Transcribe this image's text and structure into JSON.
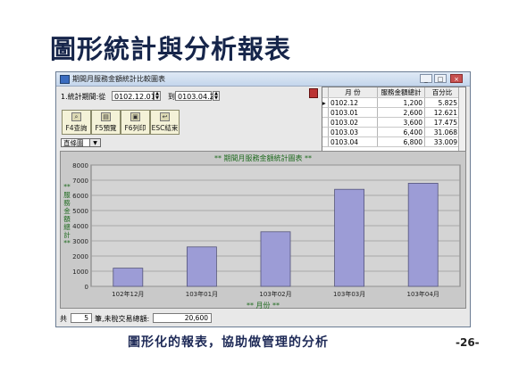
{
  "slide": {
    "title": "圖形統計與分析報表",
    "caption": "圖形化的報表，協助做管理的分析",
    "page_number": "-26-"
  },
  "window": {
    "title": "期間月服務金額統計比較圖表",
    "controls": {
      "minimize": "_",
      "maximize": "□",
      "close": "×"
    }
  },
  "filter": {
    "label": "1.統計期間:從",
    "from_value": "0102.12.01",
    "to_label": "到",
    "to_value": "0103.04.22"
  },
  "toolbar": {
    "buttons": [
      {
        "label": "F4查詢",
        "icon": "search-icon"
      },
      {
        "label": "F5預覽",
        "icon": "preview-icon"
      },
      {
        "label": "F6列印",
        "icon": "print-icon"
      },
      {
        "label": "ESC結束",
        "icon": "exit-icon"
      }
    ]
  },
  "chart_type_select": {
    "value": "直條圖"
  },
  "grid": {
    "headers": [
      "月  份",
      "服務金額總計",
      "百分比"
    ],
    "rows": [
      [
        "0102.12",
        "1,200",
        "5.825"
      ],
      [
        "0103.01",
        "2,600",
        "12.621"
      ],
      [
        "0103.02",
        "3,600",
        "17.475"
      ],
      [
        "0103.03",
        "6,400",
        "31.068"
      ],
      [
        "0103.04",
        "6,800",
        "33.009"
      ]
    ]
  },
  "status": {
    "prefix": "共",
    "count": "5",
    "middle": "筆,未稅交易總額:",
    "total": "20,600"
  },
  "chart_data": {
    "type": "bar",
    "title": "** 期間月服務金額統計圖表 **",
    "xlabel": "** 月份 **",
    "ylabel": "**服務金額總計**",
    "categories": [
      "102年12月",
      "103年01月",
      "103年02月",
      "103年03月",
      "103年04月"
    ],
    "values": [
      1200,
      2600,
      3600,
      6400,
      6800
    ],
    "ylim": [
      0,
      8000
    ],
    "yticks": [
      0,
      1000,
      2000,
      3000,
      4000,
      5000,
      6000,
      7000,
      8000
    ],
    "grid": true,
    "bar_color": "#9c9cd6",
    "plot_bg": "#d4d4d4"
  }
}
